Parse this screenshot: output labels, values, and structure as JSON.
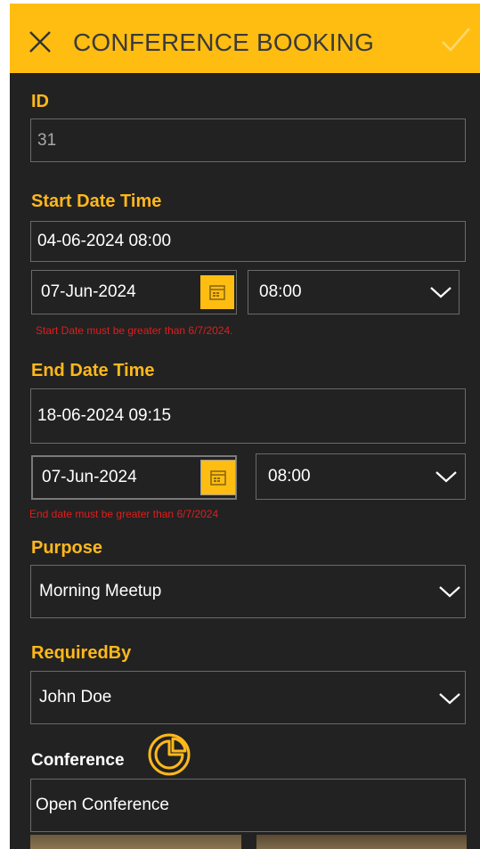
{
  "header": {
    "title": "CONFERENCE BOOKING"
  },
  "icons": {
    "close": "close-icon",
    "confirm": "check-icon",
    "calendar": "calendar-icon",
    "dropdown": "chevron-down-icon",
    "conference": "conference-icon"
  },
  "colors": {
    "accent": "#ffbd12",
    "label": "#ffb81c",
    "background": "#222222",
    "error": "#e01d1d",
    "border": "#6a6a6a"
  },
  "form": {
    "id": {
      "label": "ID",
      "value": "31"
    },
    "start": {
      "label": "Start Date Time",
      "value": "04-06-2024 08:00",
      "date": "07-Jun-2024",
      "time": "08:00",
      "error": "Start Date must be greater than 6/7/2024."
    },
    "end": {
      "label": "End Date Time",
      "value": "18-06-2024 09:15",
      "date": "07-Jun-2024",
      "time": "08:00",
      "error": "End date must be greater than  6/7/2024"
    },
    "purpose": {
      "label": "Purpose",
      "value": "Morning Meetup"
    },
    "required_by": {
      "label": "RequiredBy",
      "value": "John Doe"
    },
    "conference": {
      "label": "Conference",
      "value": "Open Conference"
    }
  }
}
